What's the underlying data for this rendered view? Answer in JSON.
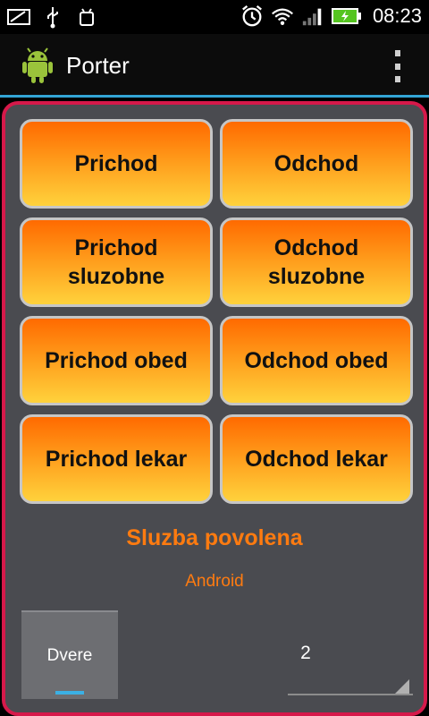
{
  "statusbar": {
    "time": "08:23"
  },
  "app": {
    "title": "Porter"
  },
  "buttons": [
    {
      "label": "Prichod"
    },
    {
      "label": "Odchod"
    },
    {
      "label": "Prichod sluzobne"
    },
    {
      "label": "Odchod sluzobne"
    },
    {
      "label": "Prichod obed"
    },
    {
      "label": "Odchod obed"
    },
    {
      "label": "Prichod lekar"
    },
    {
      "label": "Odchod lekar"
    }
  ],
  "status": {
    "main": "Sluzba povolena",
    "sub": "Android"
  },
  "bottom": {
    "tab_label": "Dvere",
    "spinner_value": "2"
  },
  "colors": {
    "accent": "#33a5d6",
    "border": "#d6194a",
    "status_text": "#ff7b10"
  }
}
